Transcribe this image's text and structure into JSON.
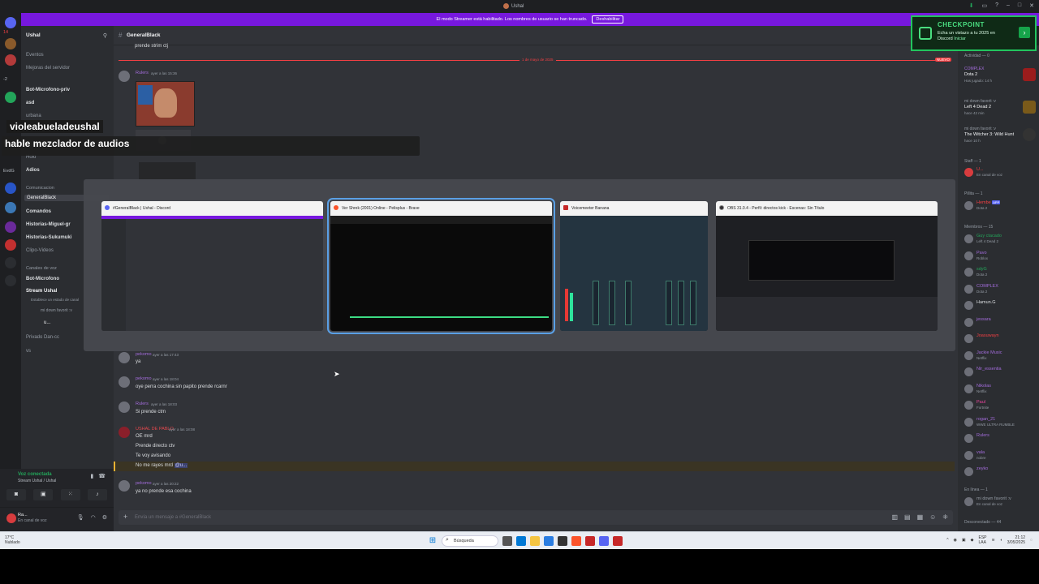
{
  "titlebar": {
    "title": "Ushal"
  },
  "streamer_bar": {
    "message": "El modo Streamer está habilitado. Los nombres de usuario se han truncado.",
    "disable": "Deshabilitar"
  },
  "server_rail": {
    "labels": [
      "14",
      "-2",
      "EvdG"
    ]
  },
  "sidebar": {
    "server_name": "Ushal",
    "items": {
      "eventos": "Eventos",
      "mejoras": "Mejoras del servidor",
      "bot_mic_priv": "Bot-Microfono-priv",
      "asd": "asd",
      "urbana": "urbana",
      "holo": "Holo",
      "adios": "Adios",
      "cat_comunicacion": "Comunicacion",
      "general": "GeneralBlack",
      "comandos": "Comandos",
      "historias_miguel": "Historias-Miguel-gr",
      "historias_sukumuki": "Historias-Sukumuki",
      "clipo_videos": "Clipo-Videos",
      "cat_canales_voz": "Canales de voz",
      "bot_microfono": "Bot-Microfono",
      "stream_ushal": "Stream Ushal",
      "stream_status": "Establece un estado de canal",
      "mi_down": "mi down favorit :v",
      "u": "u...",
      "privado": "Privado Dan-cc",
      "vs": "vs"
    }
  },
  "voice_panel": {
    "title": "Voz conectada",
    "sub": "Stream Ushal / Ushal"
  },
  "user_panel": {
    "name": "Ra...",
    "status": "En canal de voz"
  },
  "channel": {
    "name": "GeneralBlack"
  },
  "messages": {
    "m0": "prende strim ctj",
    "new_label": "1 de mayo de 2025",
    "new_badge": "NUEVO",
    "a1": "Rulers",
    "t1": "ayer a las 15:36",
    "a2": "pekomo",
    "t2": "ayer a las 17:43",
    "m2": "ya",
    "a3": "pekomo",
    "t3": "ayer a las 18:04",
    "m3": "oye perra cochina sin papito prende rcarnr",
    "a4": "Rulers",
    "t4": "ayer a las 18:03",
    "m4": "Si prende ctm",
    "a5": "USHAL DE PABLO",
    "t5": "ayer a las 18:08",
    "m5a": "OE mrd",
    "m5b": "Prende directo ctv",
    "m5c": "Te voy avisando",
    "m5d": "No me rayes mrd",
    "m5d_mention": "@u...",
    "a6": "pekomo",
    "t6": "ayer a las 20:22",
    "m6": "ya no prende esa cochina"
  },
  "input": {
    "placeholder": "Envía un mensaje a #GeneralBlack"
  },
  "overlay": {
    "name": "violeabueladeushal",
    "message": "hable mezclador de audios"
  },
  "checkpoint": {
    "title": "CHECKPOINT",
    "text": "Echa un vistazo a tu 2025 en Discord",
    "link": "Iniciar"
  },
  "members": {
    "activity_header": "Actividad — 0",
    "act1": {
      "name": "COMPLEX",
      "game": "Dota 2",
      "meta": "Has jugado: 14 h"
    },
    "act2": {
      "name": "mi down favorit :v",
      "game": "Left 4 Dead 2",
      "meta": "hace 42 min"
    },
    "act3": {
      "name": "mi down favorit :v",
      "game": "The Witcher 3: Wild Hunt",
      "meta": "hace 10 h"
    },
    "staff_header": "Staff — 1",
    "staff1": {
      "name": "U...",
      "status": "En canal de voz"
    },
    "pillita_header": "Pillita — 1",
    "pillita1": {
      "name": "Hembe",
      "status": "Dota 2"
    },
    "miembros_header": "Miembros — 15",
    "list": [
      {
        "name": "Guy ctacado",
        "status": "Left 4 Dead 2"
      },
      {
        "name": "Pavo",
        "status": "Roblox"
      },
      {
        "name": "sdyG",
        "status": "Dota 2"
      },
      {
        "name": "COMPLEX",
        "status": "Dota 2"
      },
      {
        "name": "Hamun.G",
        "status": ""
      },
      {
        "name": "jessara",
        "status": ""
      },
      {
        "name": "Joasuwayn",
        "status": ""
      },
      {
        "name": "Jackie Music",
        "status": "Netflix"
      },
      {
        "name": "Nir_essentia",
        "status": ""
      },
      {
        "name": "Nikolas",
        "status": "Netflix"
      },
      {
        "name": "Paul",
        "status": "Fortnite"
      },
      {
        "name": "rogan_21",
        "status": "WWE ULTRA RUMBLE"
      },
      {
        "name": "Rulers",
        "status": ""
      },
      {
        "name": "vala",
        "status": "nobre"
      },
      {
        "name": "zeyko",
        "status": ""
      }
    ],
    "en_linea_header": "En línea — 1",
    "en_linea1": {
      "name": "mi down favorit :v",
      "status": "En canal de voz"
    },
    "desconectado_header": "Desconectado — 44"
  },
  "switcher": {
    "windows": [
      {
        "title": "#GeneralBlack | Ushal - Discord"
      },
      {
        "title": "Ver Shrek (2001) Online - Pelisplus - Brave"
      },
      {
        "title": "Voicemeeter Banana"
      },
      {
        "title": "OBS 31.0.4 - Perfil: directos kick - Escenas: Sin Título"
      }
    ]
  },
  "taskbar": {
    "weather_temp": "17°C",
    "weather_desc": "Nublado",
    "search": "Búsqueda",
    "lang": "ESP",
    "lang2": "LAA",
    "time": "21:12",
    "date": "3/05/2025"
  }
}
